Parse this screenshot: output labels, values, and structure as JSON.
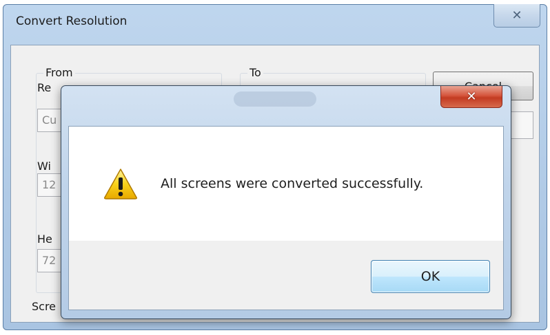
{
  "background_window": {
    "title": "Convert Resolution",
    "close_glyph": "✕",
    "from_group": {
      "legend": "From",
      "resolution_label": "Re",
      "resolution_value": "Cu",
      "width_label": "Wi",
      "width_value": "12",
      "height_label": "He",
      "height_value": "72",
      "screens_label": "Scre"
    },
    "to_group": {
      "legend": "To"
    },
    "cancel_label": "Cancel"
  },
  "message_box": {
    "close_glyph": "✕",
    "icon": "warning-icon",
    "message": "All screens were converted successfully.",
    "ok_label": "OK"
  },
  "colors": {
    "close_button_red": "#c33b22",
    "ok_button_blue": "#a7d9f5",
    "warning_yellow": "#f5c400"
  }
}
